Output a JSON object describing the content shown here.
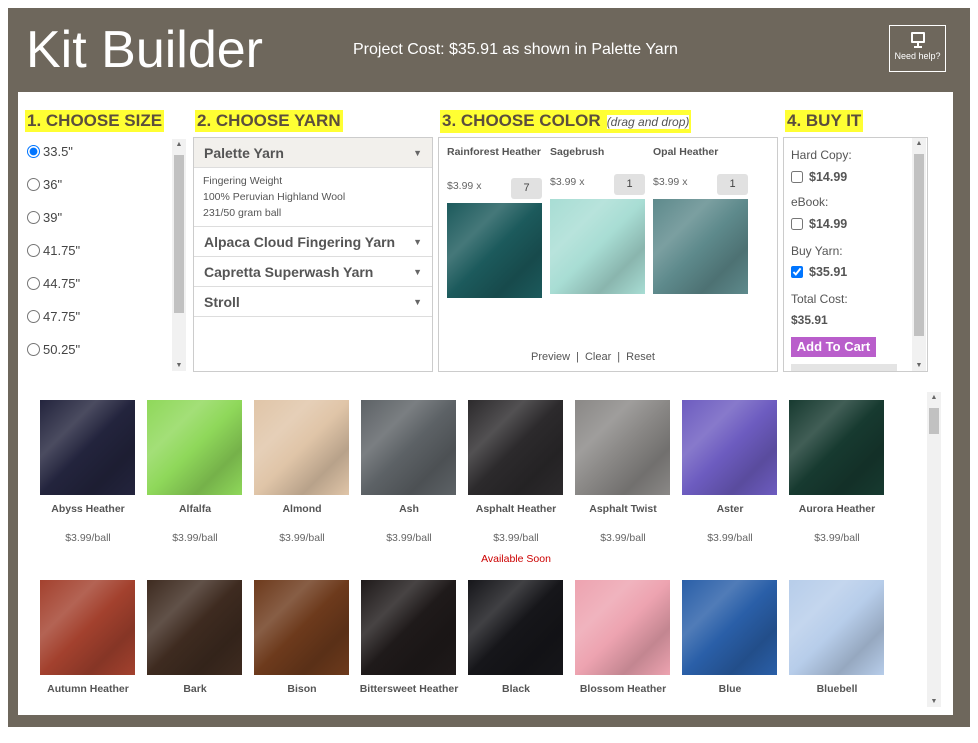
{
  "header": {
    "title": "Kit Builder",
    "project_cost": "Project Cost: $35.91 as shown in Palette Yarn",
    "help_label": "Need help?"
  },
  "steps": {
    "size": "1. CHOOSE SIZE",
    "yarn": "2. CHOOSE YARN",
    "color": "3. CHOOSE COLOR",
    "color_hint": "(drag and drop)",
    "buy": "4. BUY IT"
  },
  "sizes": [
    {
      "label": "33.5\"",
      "selected": true
    },
    {
      "label": "36\""
    },
    {
      "label": "39\""
    },
    {
      "label": "41.75\""
    },
    {
      "label": "44.75\""
    },
    {
      "label": "47.75\""
    },
    {
      "label": "50.25\""
    }
  ],
  "yarns": [
    {
      "name": "Palette Yarn",
      "desc": [
        "Fingering Weight",
        "100% Peruvian Highland Wool",
        "231/50 gram ball"
      ]
    },
    {
      "name": "Alpaca Cloud Fingering Yarn"
    },
    {
      "name": "Capretta Superwash Yarn"
    },
    {
      "name": "Stroll"
    }
  ],
  "chosen_colors": [
    {
      "name": "Rainforest Heather",
      "price": "$3.99 x",
      "qty": "7",
      "color": "#1c5a5c"
    },
    {
      "name": "Sagebrush",
      "price": "$3.99 x",
      "qty": "1",
      "color": "#a8ddd4"
    },
    {
      "name": "Opal Heather",
      "price": "$3.99 x",
      "qty": "1",
      "color": "#5e8a8c"
    }
  ],
  "color_actions": {
    "preview": "Preview",
    "clear": "Clear",
    "reset": "Reset",
    "sep": "|"
  },
  "buy": {
    "hard_copy_label": "Hard Copy:",
    "hard_copy_price": "$14.99",
    "ebook_label": "eBook:",
    "ebook_price": "$14.99",
    "yarn_label": "Buy Yarn:",
    "yarn_price": "$35.91",
    "total_label": "Total Cost:",
    "total": "$35.91",
    "add_to_cart": "Add To Cart"
  },
  "palette": [
    {
      "name": "Abyss Heather",
      "price": "$3.99/ball",
      "color": "#23243d"
    },
    {
      "name": "Alfalfa",
      "price": "$3.99/ball",
      "color": "#8fd85a"
    },
    {
      "name": "Almond",
      "price": "$3.99/ball",
      "color": "#e0c5a8"
    },
    {
      "name": "Ash",
      "price": "$3.99/ball",
      "color": "#5d6266"
    },
    {
      "name": "Asphalt Heather",
      "price": "$3.99/ball",
      "status": "Available Soon",
      "color": "#2c2a2c"
    },
    {
      "name": "Asphalt Twist",
      "price": "$3.99/ball",
      "color": "#8a8886"
    },
    {
      "name": "Aster",
      "price": "$3.99/ball",
      "color": "#6d5cc0"
    },
    {
      "name": "Aurora Heather",
      "price": "$3.99/ball",
      "color": "#173a30"
    },
    {
      "name": "Autumn Heather",
      "color": "#a3412e"
    },
    {
      "name": "Bark",
      "color": "#3e2b20"
    },
    {
      "name": "Bison",
      "color": "#6d3a1c"
    },
    {
      "name": "Bittersweet Heather",
      "color": "#1f1a1a"
    },
    {
      "name": "Black",
      "color": "#16161a"
    },
    {
      "name": "Blossom Heather",
      "color": "#eda3b0"
    },
    {
      "name": "Blue",
      "color": "#2a5fa8"
    },
    {
      "name": "Bluebell",
      "color": "#b7cdea"
    }
  ],
  "colors": {
    "frame": "#6e675c",
    "highlight": "#ffff33",
    "cart": "#b95ecb",
    "available_soon": "#cc0000"
  }
}
